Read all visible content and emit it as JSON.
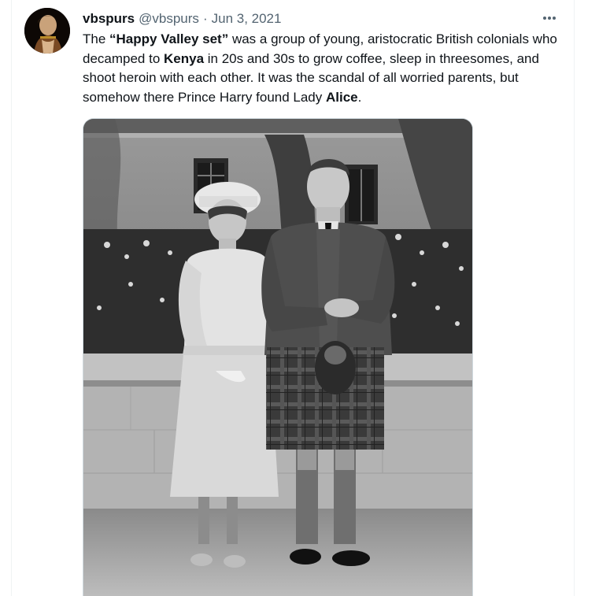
{
  "tweet": {
    "display_name": "vbspurs",
    "handle": "@vbspurs",
    "separator": "·",
    "date": "Jun 3, 2021",
    "text_parts": [
      "The ",
      "“Happy Valley set”",
      " was a group of young, aristocratic British colonials who decamped to ",
      "Kenya",
      " in 20s and 30s to grow coffee, sleep in threesomes, and shoot heroin with each other. It was the scandal of all worried parents, but somehow there Prince Harry found Lady ",
      "Alice",
      "."
    ]
  },
  "icons": {
    "avatar": "profile-portrait",
    "more": "more-options-icon"
  },
  "media": {
    "description_type": "black-and-white photograph"
  },
  "colors": {
    "text": "#0f1419",
    "secondary": "#536471",
    "border": "#eff3f4"
  }
}
